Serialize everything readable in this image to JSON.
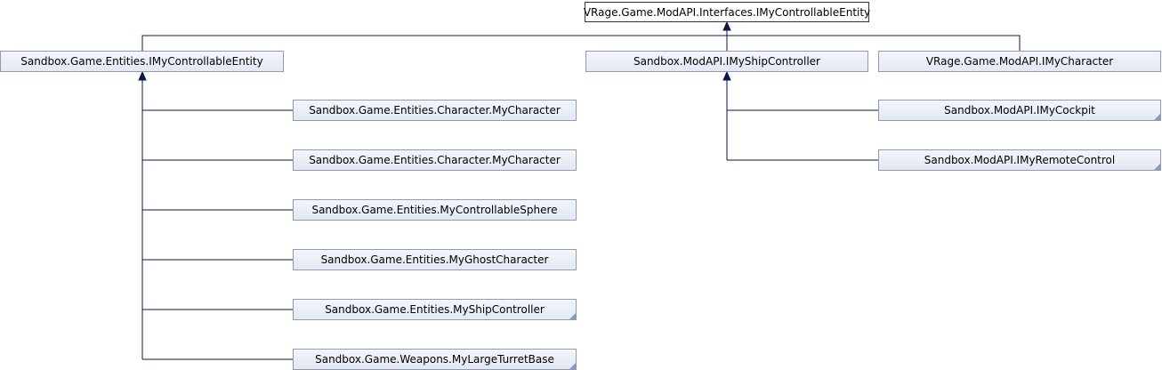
{
  "diagram": {
    "root": {
      "label": "VRage.Game.ModAPI.Interfaces.IMyControllableEntity"
    },
    "level1": [
      {
        "label": "Sandbox.Game.Entities.IMyControllableEntity"
      },
      {
        "label": "Sandbox.ModAPI.IMyShipController"
      },
      {
        "label": "VRage.Game.ModAPI.IMyCharacter"
      }
    ],
    "entity_children": [
      {
        "label": "Sandbox.Game.Entities.Character.MyCharacter"
      },
      {
        "label": "Sandbox.Game.Entities.Character.MyCharacter"
      },
      {
        "label": "Sandbox.Game.Entities.MyControllableSphere"
      },
      {
        "label": "Sandbox.Game.Entities.MyGhostCharacter"
      },
      {
        "label": "Sandbox.Game.Entities.MyShipController"
      },
      {
        "label": "Sandbox.Game.Weapons.MyLargeTurretBase"
      }
    ],
    "ship_children": [
      {
        "label": "Sandbox.ModAPI.IMyCockpit"
      },
      {
        "label": "Sandbox.ModAPI.IMyRemoteControl"
      }
    ]
  }
}
